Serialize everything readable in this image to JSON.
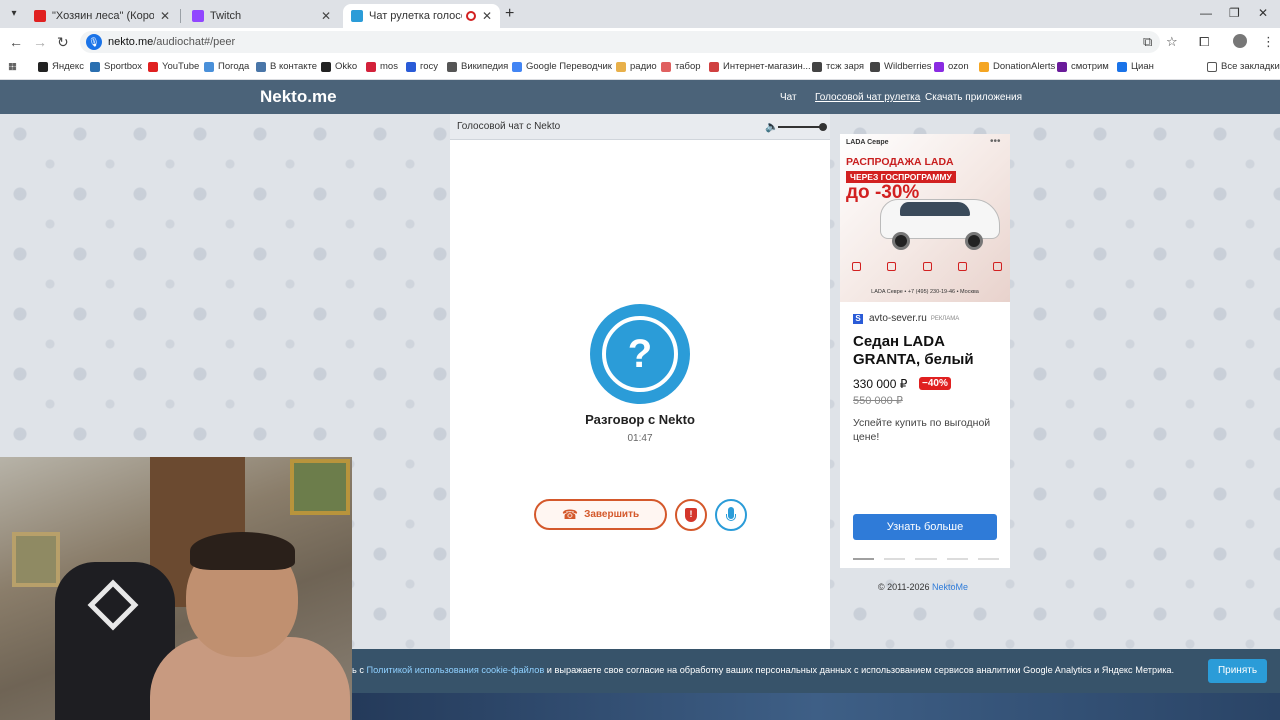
{
  "browser": {
    "tabs": [
      {
        "title": "\"Хозяин леса\" (Король и Шут)",
        "color": "#e02020"
      },
      {
        "title": "Twitch",
        "color": "#9146ff"
      },
      {
        "title": "Чат рулетка голосовая — ",
        "color": "#2b9cd8"
      }
    ],
    "url_host": "nekto.me",
    "url_path": "/audiochat#/peer",
    "bookmarks": [
      {
        "label": "Яндекс",
        "color": "#222222"
      },
      {
        "label": "Sportbox",
        "color": "#2a6fb0"
      },
      {
        "label": "YouTube",
        "color": "#e02020"
      },
      {
        "label": "Погода",
        "color": "#4a90d9"
      },
      {
        "label": "В контакте",
        "color": "#4a76a8"
      },
      {
        "label": "Okko",
        "color": "#222222"
      },
      {
        "label": "mos",
        "color": "#d3213a"
      },
      {
        "label": "госу",
        "color": "#2a5bd7"
      },
      {
        "label": "Википедия",
        "color": "#555555"
      },
      {
        "label": "Google Переводчик",
        "color": "#4285f4"
      },
      {
        "label": "радио",
        "color": "#e8b04a"
      },
      {
        "label": "табор",
        "color": "#e06060"
      },
      {
        "label": "Интернет-магазин...",
        "color": "#d04040"
      },
      {
        "label": "тсж заря",
        "color": "#444444"
      },
      {
        "label": "Wildberries",
        "color": "#444444"
      },
      {
        "label": "ozon",
        "color": "#8a2be2"
      },
      {
        "label": "DonationAlerts",
        "color": "#f5a623"
      },
      {
        "label": "смотрим",
        "color": "#6a1b9a"
      },
      {
        "label": "Циан",
        "color": "#1a73e8"
      }
    ],
    "all_bookmarks": "Все закладки"
  },
  "site": {
    "logo": "Nekto.me",
    "nav": [
      "Чат",
      "Голосовой чат рулетка",
      "Скачать приложения"
    ]
  },
  "chat": {
    "title": "Голосовой чат с Nekto",
    "avatar_symbol": "?",
    "peer": "Разговор с Nekto",
    "timer": "01:47",
    "end_label": "Завершить"
  },
  "ad": {
    "brand": "LADA Севре",
    "headline1": "РАСПРОДАЖА LADA",
    "headline2": "ЧЕРЕЗ ГОСПРОГРАММУ",
    "headline3": "до -30%",
    "footer": "LADA Севре • +7 (495) 230-19-46 • Москва",
    "source": "avto-sever.ru",
    "source_tag": "РЕКЛАМА",
    "title": "Седан LADA GRANTA, белый",
    "price": "330 000 ₽",
    "discount": "−40%",
    "old_price": "550 000 ₽",
    "desc": "Успейте купить по выгодной цене!",
    "button": "Узнать больше"
  },
  "copyright": {
    "text": "© 2011-2026 ",
    "link": "NektoMe"
  },
  "cookie": {
    "prefix": "ь с ",
    "link": "Политикой использования cookie-файлов",
    "suffix": " и выражаете свое согласие на обработку ваших персональных данных с использованием сервисов аналитики Google Analytics и Яндекс Метрика.",
    "button": "Принять"
  },
  "colors": {
    "header": "#4b6379",
    "accent_blue": "#2b9cd8",
    "end_red": "#d4582b"
  }
}
